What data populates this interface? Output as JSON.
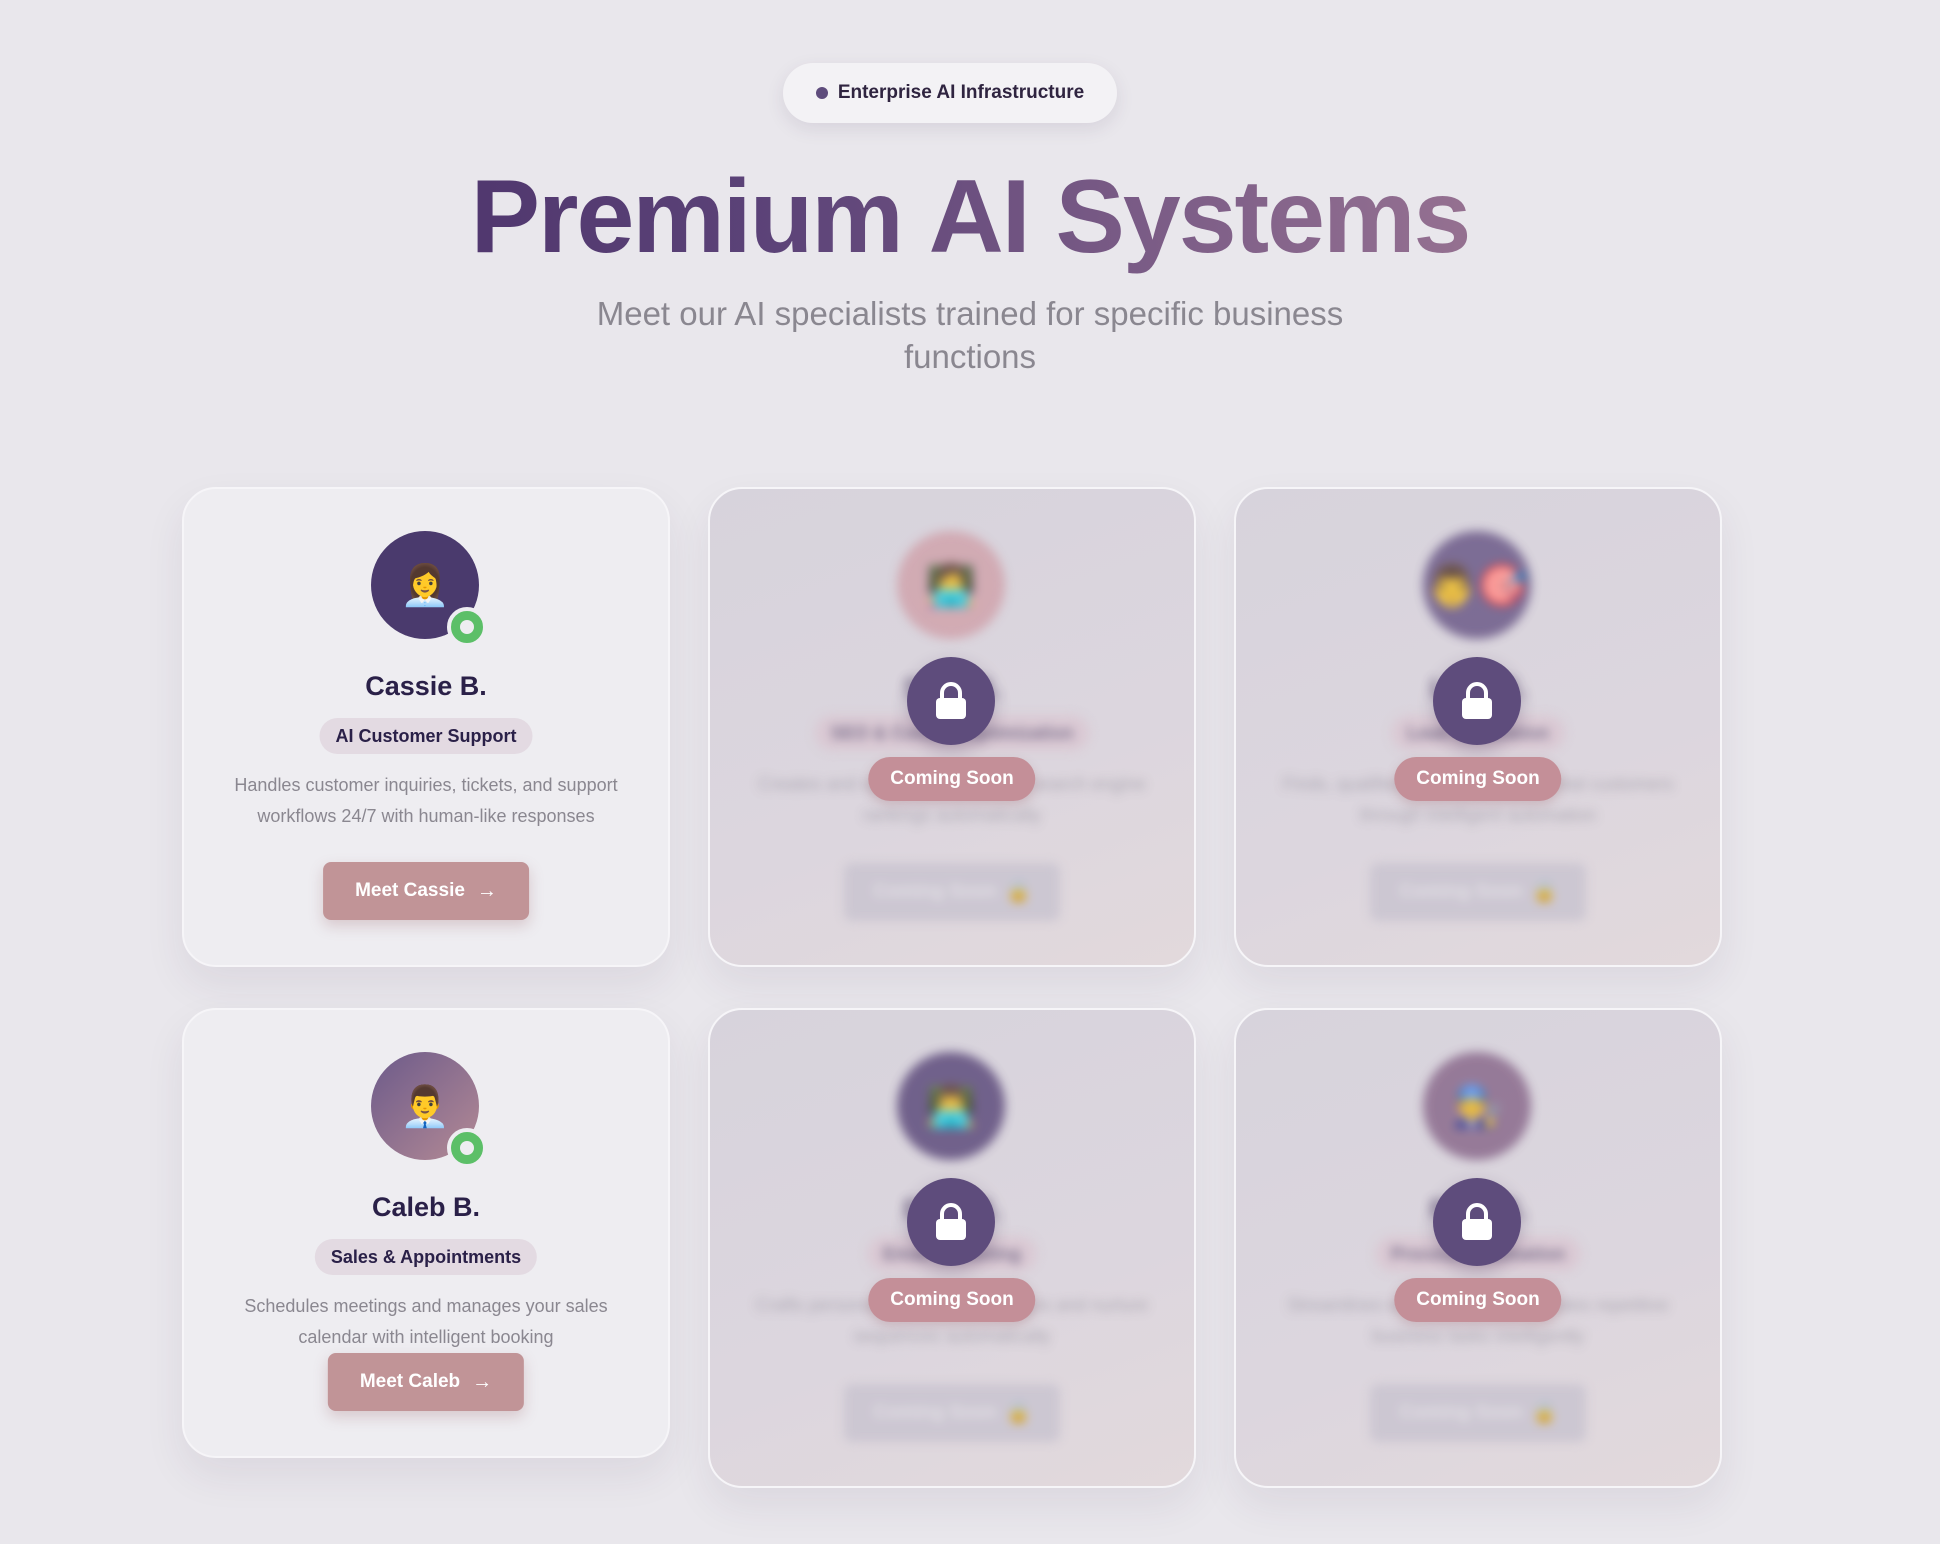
{
  "header": {
    "badge": "Enterprise AI Infrastructure",
    "title_part1": "Premium",
    "title_part2": "AI",
    "title_part3": "Systems",
    "subtitle": "Meet our AI specialists trained for specific business functions"
  },
  "colors": {
    "background": "#e9e7ec",
    "accent_dark": "#5e4c7c",
    "cta": "#c19497",
    "online": "#5cbf68"
  },
  "agents": [
    {
      "name": "Cassie B.",
      "role": "AI Customer Support",
      "description": "Handles customer inquiries, tickets, and support workflows 24/7 with human-like responses",
      "cta": "Meet Cassie",
      "avatar_icon": "👩‍💼",
      "status": "online"
    },
    {
      "name": "Caleb B.",
      "role": "Sales & Appointments",
      "description": "Schedules meetings and manages your sales calendar with intelligent booking",
      "cta": "Meet Caleb",
      "avatar_icon": "👨‍💼",
      "status": "online"
    }
  ],
  "locked_agents": [
    {
      "name": "S___ B.",
      "role": "SEO & Content Optimization",
      "description": "Creates and optimizes content for search engine rankings automatically",
      "overlay_label": "Coming Soon",
      "button_label": "Coming Soon"
    },
    {
      "name": "L___ B.",
      "role": "Lead Generation",
      "description": "Finds, qualifies and engages potential customers through intelligent automation",
      "overlay_label": "Coming Soon",
      "button_label": "Coming Soon"
    },
    {
      "name": "E___ B.",
      "role": "Email Marketing",
      "description": "Crafts personalized email campaigns and nurture sequences automatically",
      "overlay_label": "Coming Soon",
      "button_label": "Coming Soon"
    },
    {
      "name": "P___ B.",
      "role": "Process Automation",
      "description": "Streamlines workflows and automates repetitive business tasks intelligently",
      "overlay_label": "Coming Soon",
      "button_label": "Coming Soon"
    }
  ]
}
